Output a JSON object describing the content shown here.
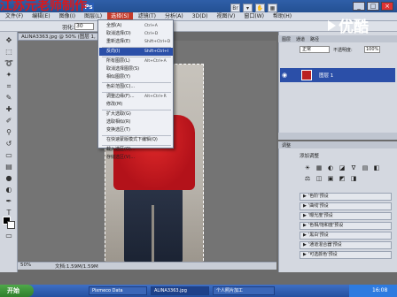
{
  "watermark": {
    "top": "江苏元老师制作",
    "bottom": "江苏元老师制作"
  },
  "youku": {
    "text": "优酷"
  },
  "app": {
    "logo": "Ps"
  },
  "menubar": {
    "items": [
      "文件(F)",
      "编辑(E)",
      "图像(I)",
      "图层(L)",
      "选择(S)",
      "滤镜(T)",
      "分析(A)",
      "3D(D)",
      "视图(V)",
      "窗口(W)",
      "帮助(H)"
    ],
    "active_index": 4
  },
  "options": {
    "feather_label": "羽化:",
    "feather_value": "30"
  },
  "document": {
    "tab_title": "ALINA3363.jpg @ 50% (图层 1, RGB/8)"
  },
  "select_menu": {
    "items": [
      {
        "label": "全部(A)",
        "shortcut": "Ctrl+A"
      },
      {
        "label": "取消选择(D)",
        "shortcut": "Ctrl+D"
      },
      {
        "label": "重新选择(E)",
        "shortcut": "Shift+Ctrl+D"
      },
      {
        "label": "反向(I)",
        "shortcut": "Shift+Ctrl+I"
      },
      {
        "label": "所有图层(L)",
        "shortcut": "Alt+Ctrl+A"
      },
      {
        "label": "取消选择图层(S)",
        "shortcut": ""
      },
      {
        "label": "相似图层(Y)",
        "shortcut": ""
      },
      {
        "label": "色彩范围(C)...",
        "shortcut": ""
      },
      {
        "label": "调整边缘(F)...",
        "shortcut": "Alt+Ctrl+R"
      },
      {
        "label": "修改(M)",
        "shortcut": ""
      },
      {
        "label": "扩大选取(G)",
        "shortcut": ""
      },
      {
        "label": "选取相似(R)",
        "shortcut": ""
      },
      {
        "label": "变换选区(T)",
        "shortcut": ""
      },
      {
        "label": "在快速蒙版模式下编辑(Q)",
        "shortcut": ""
      },
      {
        "label": "载入选区(O)...",
        "shortcut": ""
      },
      {
        "label": "存储选区(V)...",
        "shortcut": ""
      }
    ],
    "highlight_index": 3
  },
  "statusbar": {
    "zoom": "50%",
    "doc_size": "文档:1.59M/1.59M"
  },
  "layers_panel": {
    "tabs": [
      "图层",
      "通道",
      "路径"
    ],
    "blend_mode": "正常",
    "opacity_label": "不透明度:",
    "opacity_value": "100%",
    "layer_name": "图层 1"
  },
  "adjustments_panel": {
    "tab": "调整",
    "title": "添加调整",
    "icons": [
      "☀",
      "▦",
      "◐",
      "◪",
      "∇",
      "▤",
      "◧",
      "⚖",
      "◫",
      "▣",
      "◩",
      "◨"
    ],
    "presets": [
      "'色阶'预设",
      "'曲线'预设",
      "'曝光度'预设",
      "'色相/饱和度'预设",
      "'黑白'预设",
      "'通道混合器'预设",
      "'可选颜色'预设"
    ]
  },
  "taskbar": {
    "start": "开始",
    "tasks": [
      "Pixmeco Data",
      "ALINA3363.jpg",
      "个人照片加工"
    ],
    "clock": "16:08"
  },
  "colors": {
    "highlight": "#2b4fa8",
    "jacket": "#c4161e"
  }
}
